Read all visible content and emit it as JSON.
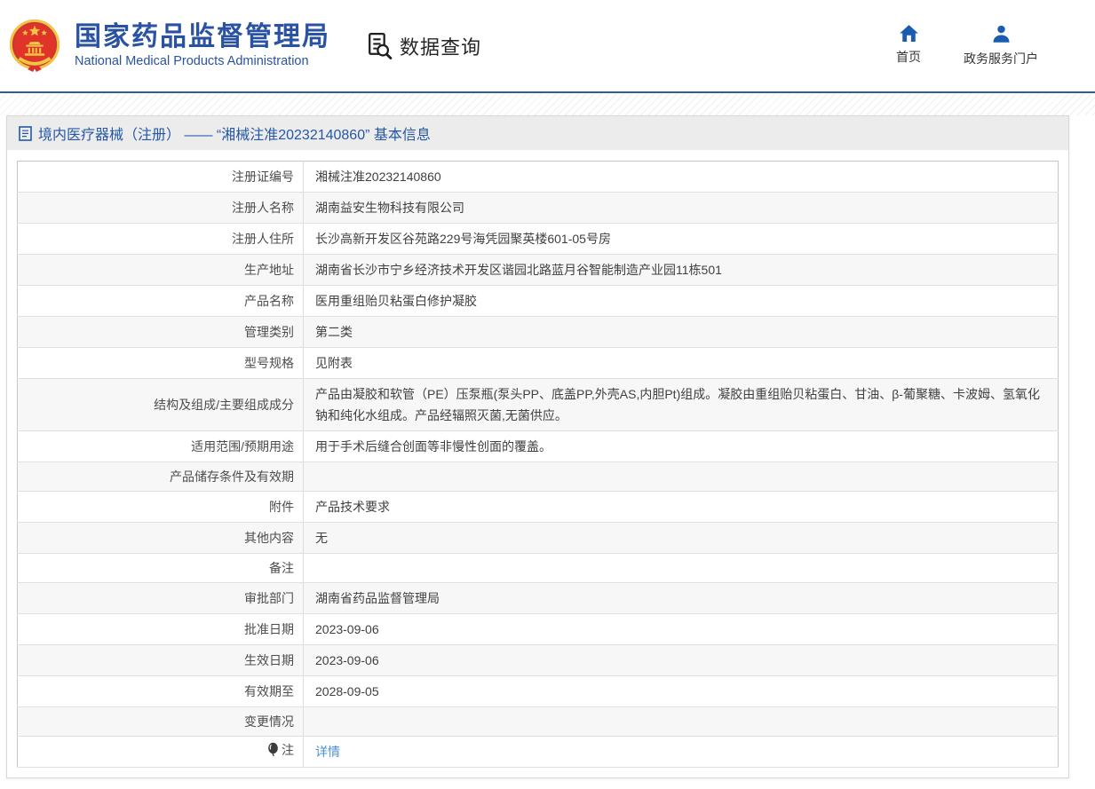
{
  "header": {
    "logo": {
      "icon": "china-national-emblem",
      "title": "国家药品监督管理局",
      "subtitle": "National Medical Products Administration"
    },
    "section": {
      "icon": "document-search-icon",
      "label": "数据查询"
    },
    "nav": [
      {
        "icon": "home-icon",
        "label": "首页"
      },
      {
        "icon": "user-icon",
        "label": "政务服务门户"
      }
    ]
  },
  "page": {
    "title_icon": "document-icon",
    "title": "境内医疗器械（注册） —— “湘械注准20232140860” 基本信息"
  },
  "table": {
    "rows": [
      {
        "label": "注册证编号",
        "value": "湘械注准20232140860"
      },
      {
        "label": "注册人名称",
        "value": "湖南益安生物科技有限公司"
      },
      {
        "label": "注册人住所",
        "value": "长沙高新开发区谷苑路229号海凭园聚英楼601-05号房"
      },
      {
        "label": "生产地址",
        "value": "湖南省长沙市宁乡经济技术开发区谐园北路蓝月谷智能制造产业园11栋501"
      },
      {
        "label": "产品名称",
        "value": "医用重组贻贝粘蛋白修护凝胶"
      },
      {
        "label": "管理类别",
        "value": "第二类"
      },
      {
        "label": "型号规格",
        "value": "见附表"
      },
      {
        "label": "结构及组成/主要组成成分",
        "value": "产品由凝胶和软管（PE）压泵瓶(泵头PP、底盖PP,外壳AS,内胆Pt)组成。凝胶由重组贻贝粘蛋白、甘油、β-葡聚糖、卡波姆、氢氧化钠和纯化水组成。产品经辐照灭菌,无菌供应。"
      },
      {
        "label": "适用范围/预期用途",
        "value": "用于手术后缝合创面等非慢性创面的覆盖。"
      },
      {
        "label": "产品储存条件及有效期",
        "value": ""
      },
      {
        "label": "附件",
        "value": "产品技术要求"
      },
      {
        "label": "其他内容",
        "value": "无"
      },
      {
        "label": "备注",
        "value": ""
      },
      {
        "label": "审批部门",
        "value": "湖南省药品监督管理局"
      },
      {
        "label": "批准日期",
        "value": "2023-09-06"
      },
      {
        "label": "生效日期",
        "value": "2023-09-06"
      },
      {
        "label": "有效期至",
        "value": "2028-09-05"
      },
      {
        "label": "变更情况",
        "value": ""
      },
      {
        "label": "注",
        "value": "详情",
        "label_icon": "note-balloon-icon"
      }
    ]
  },
  "colors": {
    "brand_blue": "#2a52a2",
    "header_rule_blue": "#2e5f94",
    "title_bar_bg": "#ececec",
    "page_title_blue": "#2458a6",
    "row_alt_bg": "#f7f7f7",
    "link_blue": "#4a90d9",
    "icon_blue": "#1a5cb0",
    "emblem_red": "#e0342b",
    "emblem_gold": "#f2c545"
  }
}
